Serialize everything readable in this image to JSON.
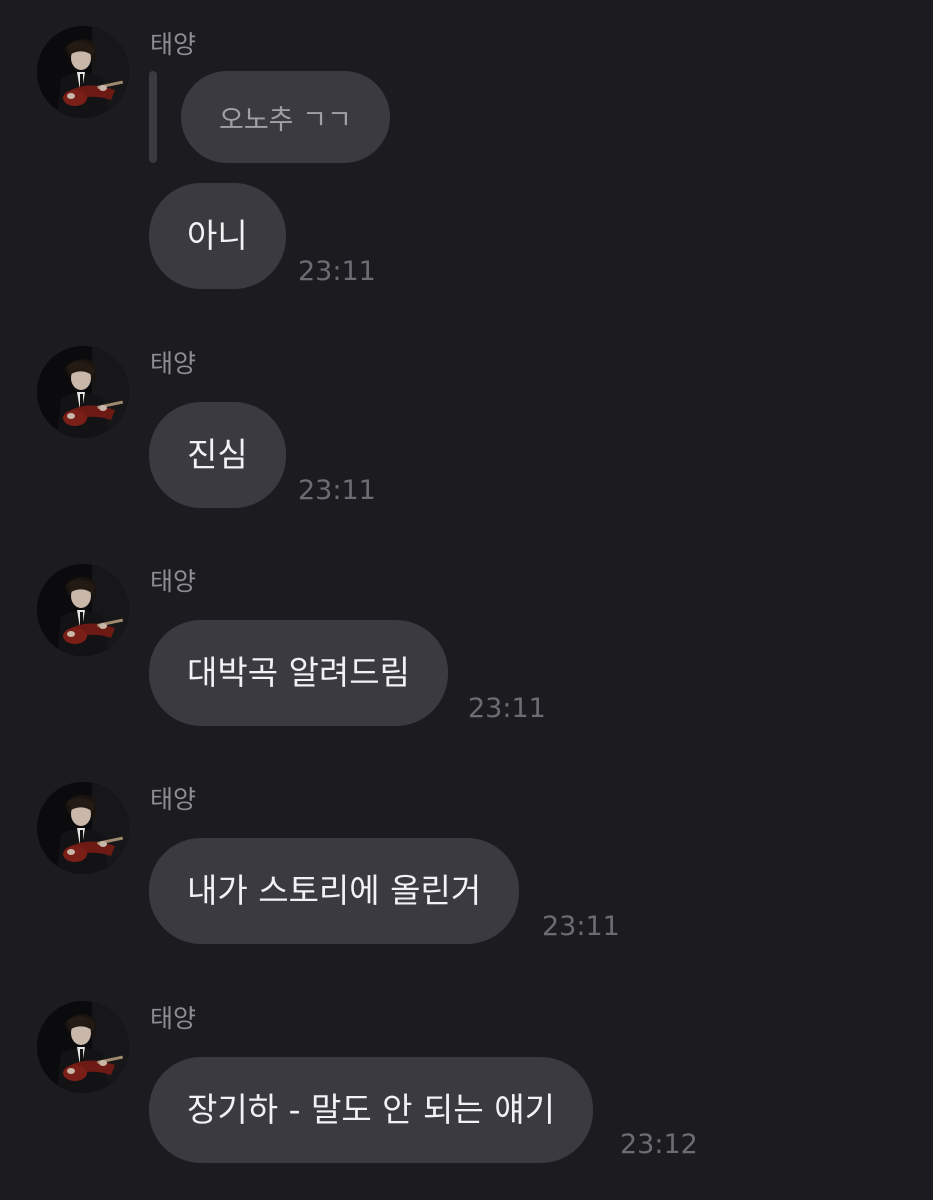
{
  "chat": {
    "messages": [
      {
        "sender": "태양",
        "reply": "오노추 ㄱㄱ",
        "text": "아니",
        "time": "23:11"
      },
      {
        "sender": "태양",
        "text": "진심",
        "time": "23:11"
      },
      {
        "sender": "태양",
        "text": "대박곡 알려드림",
        "time": "23:11"
      },
      {
        "sender": "태양",
        "text": "내가 스토리에 올린거",
        "time": "23:11"
      },
      {
        "sender": "태양",
        "text": "장기하 - 말도 안 되는 얘기",
        "time": "23:12"
      }
    ]
  },
  "colors": {
    "background": "#1c1c20",
    "bubble": "#3a3a40",
    "bubble_text": "#f2f2f4",
    "sender_text": "#8d8d93",
    "timestamp_text": "#6c6c72",
    "reply_text": "#a0a0a6"
  }
}
